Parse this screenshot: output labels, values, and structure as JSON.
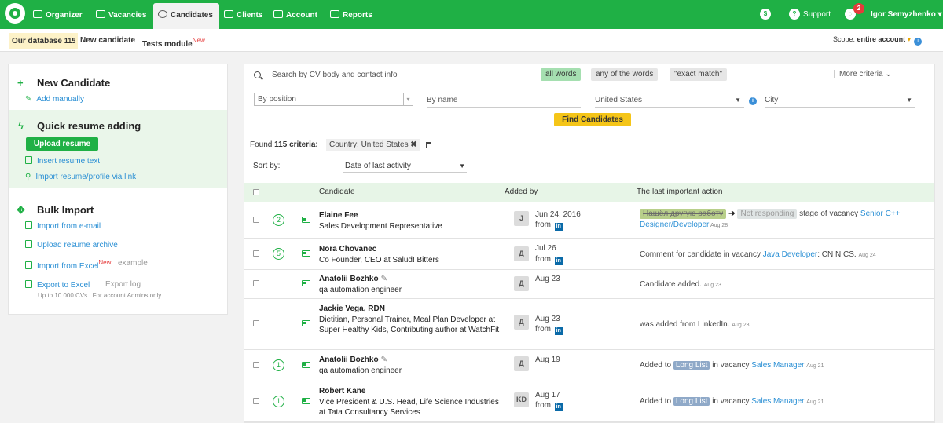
{
  "topnav": {
    "items": [
      {
        "label": "Organizer",
        "icon": "organizer-icon"
      },
      {
        "label": "Vacancies",
        "icon": "vacancies-icon"
      },
      {
        "label": "Candidates",
        "icon": "candidates-icon",
        "active": true
      },
      {
        "label": "Clients",
        "icon": "clients-icon"
      },
      {
        "label": "Account",
        "icon": "account-icon"
      },
      {
        "label": "Reports",
        "icon": "reports-icon"
      }
    ],
    "dollar_icon": "$",
    "support_label": "Support",
    "support_icon": "?",
    "notifications_count": "2",
    "user_name": "Igor Semyzhenko",
    "user_caret": "▾"
  },
  "subnav": {
    "our_database_label": "Our database",
    "our_database_count": "115",
    "new_candidate_label": "New candidate",
    "tests_module_label": "Tests module",
    "new_badge": "New",
    "scope_prefix": "Scope:",
    "scope_value": "entire account"
  },
  "left_panel": {
    "new_candidate": {
      "title": "New Candidate",
      "add_manually": "Add manually"
    },
    "quick_resume": {
      "title": "Quick resume adding",
      "upload_resume": "Upload resume",
      "insert_resume_text": "Insert resume text",
      "import_via_link": "Import resume/profile via link"
    },
    "bulk_import": {
      "title": "Bulk Import",
      "import_email": "Import from e-mail",
      "upload_archive": "Upload resume archive",
      "import_excel": "Import from Excel",
      "new_badge": "New",
      "example": "example",
      "export_excel": "Export to Excel",
      "export_log": "Export log",
      "note": "Up to 10 000 CVs | For account Admins only"
    }
  },
  "search": {
    "placeholder": "Search by CV body and contact info",
    "mode_all": "all words",
    "mode_any": "any of the words",
    "mode_exact": "\"exact match\"",
    "more_criteria": "More criteria",
    "position_placeholder": "By position",
    "name_placeholder": "By name",
    "country": "United States",
    "city_placeholder": "City",
    "find_button": "Find Candidates"
  },
  "results": {
    "found_label": "Found",
    "found_count": "115",
    "criteria_label": "criteria:",
    "criteria_tag": "Country: United States",
    "sort_label": "Sort by:",
    "sort_value": "Date of last activity"
  },
  "table": {
    "headers": {
      "candidate": "Candidate",
      "added_by": "Added by",
      "last_action": "The last important action"
    },
    "rows": [
      {
        "count": "2",
        "name": "Elaine Fee",
        "position": "Sales Development Representative",
        "avatar": "J",
        "date": "Jun 24, 2016",
        "from": "from",
        "action_strike": "Нашёл другую работу",
        "action_status": "Not responding",
        "action_text": "stage of vacancy",
        "action_link": "Senior C++ Designer/Developer",
        "action_date": "Aug 28"
      },
      {
        "count": "5",
        "name": "Nora Chovanec",
        "position": "Co Founder, CEO at Salud! Bitters",
        "avatar": "Д",
        "date": "Jul 26",
        "from": "from",
        "action_text": "Comment for candidate in vacancy",
        "action_link": "Java Developer",
        "action_suffix": ": CN N CS.",
        "action_date": "Aug 24"
      },
      {
        "name": "Anatolii Bozhko",
        "position": "qa automation engineer",
        "avatar": "Д",
        "date": "Aug 23",
        "action_text": "Candidate added.",
        "action_date": "Aug 23"
      },
      {
        "name": "Jackie Vega, RDN",
        "position": "Dietitian, Personal Trainer, Meal Plan Developer at Super Healthy Kids, Contributing author at WatchFit",
        "avatar": "Д",
        "date": "Aug 23",
        "from": "from",
        "action_text": "was added from LinkedIn.",
        "action_date": "Aug 23"
      },
      {
        "count": "1",
        "name": "Anatolii Bozhko",
        "position": "qa automation engineer",
        "avatar": "Д",
        "date": "Aug 19",
        "action_prefix": "Added to",
        "action_tag": "Long List",
        "action_text": "in vacancy",
        "action_link": "Sales Manager",
        "action_date": "Aug 21"
      },
      {
        "count": "1",
        "name": "Robert Kane",
        "position": "Vice President & U.S. Head, Life Science Industries at Tata Consultancy Services",
        "avatar": "KD",
        "date": "Aug 17",
        "from": "from",
        "action_prefix": "Added to",
        "action_tag": "Long List",
        "action_text": "in vacancy",
        "action_link": "Sales Manager",
        "action_date": "Aug 21"
      }
    ]
  },
  "colors": {
    "brand_green": "#1fb045",
    "link_blue": "#2a8fd4",
    "find_yellow": "#f5c518"
  }
}
